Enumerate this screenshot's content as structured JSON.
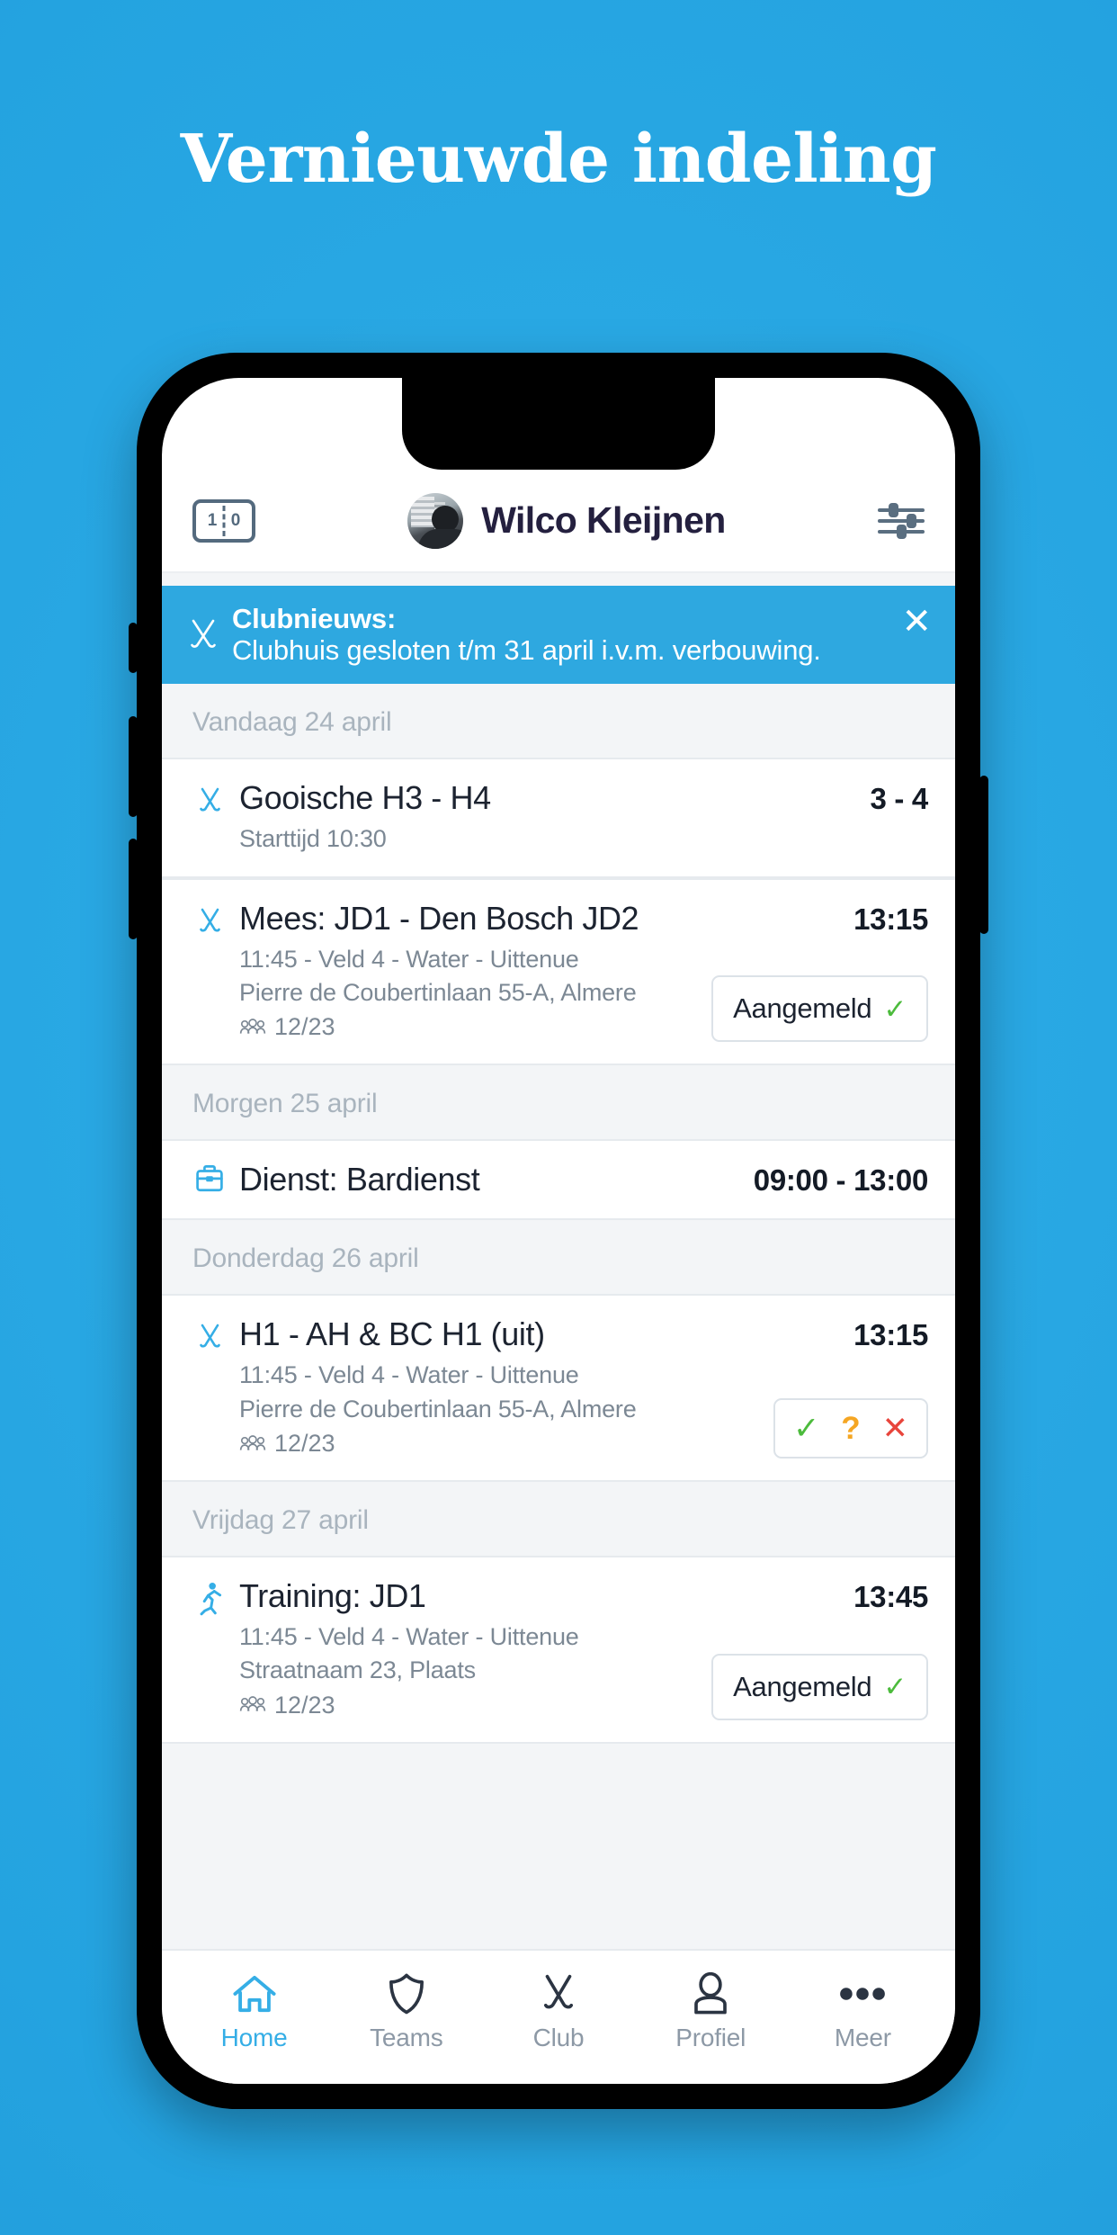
{
  "page": {
    "headline": "Vernieuwde indeling",
    "background_color": "#26A4E3"
  },
  "app": {
    "header": {
      "scoreboard_icon": "scoreboard-icon",
      "score_left": "1",
      "score_right": "0",
      "avatar_icon": "avatar",
      "user_name": "Wilco Kleijnen",
      "settings_icon": "sliders-icon"
    },
    "banner": {
      "icon": "hockey-sticks-icon",
      "title": "Clubnieuws:",
      "message": "Clubhuis gesloten t/m 31 april i.v.m. verbouwing.",
      "close_icon": "close-icon",
      "color": "#2EA8E0"
    },
    "sections": [
      {
        "date_label": "Vandaag 24 april",
        "events": [
          {
            "icon": "hockey-sticks-icon",
            "title": "Gooische H3 - H4",
            "right": "3 - 4",
            "meta": [
              "Starttijd 10:30"
            ],
            "attendance": null,
            "action": null
          },
          {
            "icon": "hockey-sticks-icon",
            "title": "Mees: JD1 - Den Bosch JD2",
            "right": "13:15",
            "meta": [
              "11:45 - Veld 4 - Water - Uittenue",
              "Pierre de Coubertinlaan 55-A, Almere"
            ],
            "attendance": "12/23",
            "action": {
              "type": "signed",
              "label": "Aangemeld",
              "check_icon": "check-icon",
              "check_color": "#4CBB3C"
            }
          }
        ]
      },
      {
        "date_label": "Morgen 25 april",
        "events": [
          {
            "icon": "briefcase-icon",
            "title": "Dienst: Bardienst",
            "right": "09:00 - 13:00",
            "meta": [],
            "attendance": null,
            "action": null
          }
        ]
      },
      {
        "date_label": "Donderdag 26 april",
        "events": [
          {
            "icon": "hockey-sticks-icon",
            "title": "H1 - AH & BC H1 (uit)",
            "right": "13:15",
            "meta": [
              "11:45 - Veld 4 - Water - Uittenue",
              "Pierre de Coubertinlaan 55-A, Almere"
            ],
            "attendance": "12/23",
            "action": {
              "type": "choice",
              "yes_icon": "check-icon",
              "yes_glyph": "✓",
              "yes_color": "#4CBB3C",
              "maybe_icon": "question-icon",
              "maybe_glyph": "?",
              "maybe_color": "#F5A623",
              "no_icon": "cross-icon",
              "no_glyph": "✕",
              "no_color": "#E8453C"
            }
          }
        ]
      },
      {
        "date_label": "Vrijdag 27 april",
        "events": [
          {
            "icon": "runner-icon",
            "title": "Training: JD1",
            "right": "13:45",
            "meta": [
              "11:45 - Veld 4 - Water - Uittenue",
              "Straatnaam 23, Plaats"
            ],
            "attendance": "12/23",
            "action": {
              "type": "signed",
              "label": "Aangemeld",
              "check_icon": "check-icon",
              "check_color": "#4CBB3C"
            }
          }
        ]
      }
    ],
    "tabbar": {
      "active_color": "#35AEE6",
      "inactive_color": "#8D99A6",
      "items": [
        {
          "icon": "home-icon",
          "label": "Home",
          "active": true
        },
        {
          "icon": "shield-icon",
          "label": "Teams",
          "active": false
        },
        {
          "icon": "hockey-sticks-icon",
          "label": "Club",
          "active": false
        },
        {
          "icon": "person-icon",
          "label": "Profiel",
          "active": false
        },
        {
          "icon": "ellipsis-icon",
          "label": "Meer",
          "active": false
        }
      ]
    }
  }
}
